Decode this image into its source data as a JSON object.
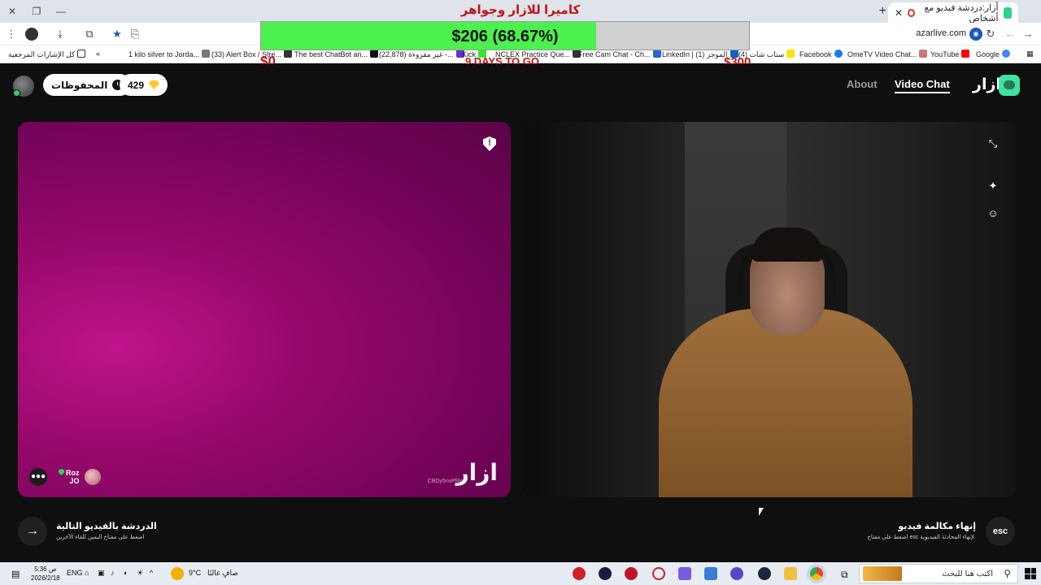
{
  "browser": {
    "tab_title": "أزار:دردشة فيديو مع أشخاص",
    "url": "azarlive.com",
    "bookmarks": [
      {
        "label": "كل الإشارات المرجعية"
      },
      {
        "label": "1 kilo silver to Jorda..."
      },
      {
        "label": "(33) Alert Box / Stre..."
      },
      {
        "label": "The best ChatBot an..."
      },
      {
        "label": "(22,878) غير مقروءة -..."
      },
      {
        "label": "Kick"
      },
      {
        "label": "NCLEX Practice Que..."
      },
      {
        "label": "Free Cam Chat - Ch..."
      },
      {
        "label": "LinkedIn | (1) الموجز"
      },
      {
        "label": "(4) سناب شات"
      },
      {
        "label": "Facebook"
      },
      {
        "label": "OmeTV Video Chat..."
      },
      {
        "label": "YouTube"
      },
      {
        "label": "Google"
      }
    ]
  },
  "donation": {
    "title": "كاميرا للازار وجواهر",
    "progress_text": "$206 (68.67%)",
    "progress_fraction": 0.6867,
    "min_label": "$0",
    "max_label": "$300",
    "days_left": "9 DAYS TO GO"
  },
  "header": {
    "gems_count": "429",
    "saved_label": "المحفوظات",
    "nav_about": "About",
    "nav_video_chat": "Video Chat",
    "brand_name": "ازار"
  },
  "remote_video": {
    "watermark": "ازار",
    "watermark_id": "CBDy5nvPRw",
    "peer_name": "Roz",
    "peer_country": "JO"
  },
  "actions": {
    "next_title": "الدردشة بالفيديو التالية",
    "next_subtitle": "اضغط على مفتاح اليمين للقاء الآخرين",
    "end_title": "إنهاء مكالمة فيديو",
    "end_subtitle": "اضغط على مفتاح esc لإنهاء المحادثة الفيديوية.",
    "esc_label": "esc"
  },
  "taskbar": {
    "time": "5:36 ص",
    "date": "2026/2/18",
    "language": "ENG",
    "weather_temp": "9°C",
    "weather_desc": "صافٍ غالبًا",
    "search_placeholder": "اكتب هنا للبحث"
  },
  "colors": {
    "brand_green": "#41e2a0",
    "progress_green": "#4cf14f",
    "donation_red": "#c01616",
    "remote_magenta": "#95086a"
  }
}
